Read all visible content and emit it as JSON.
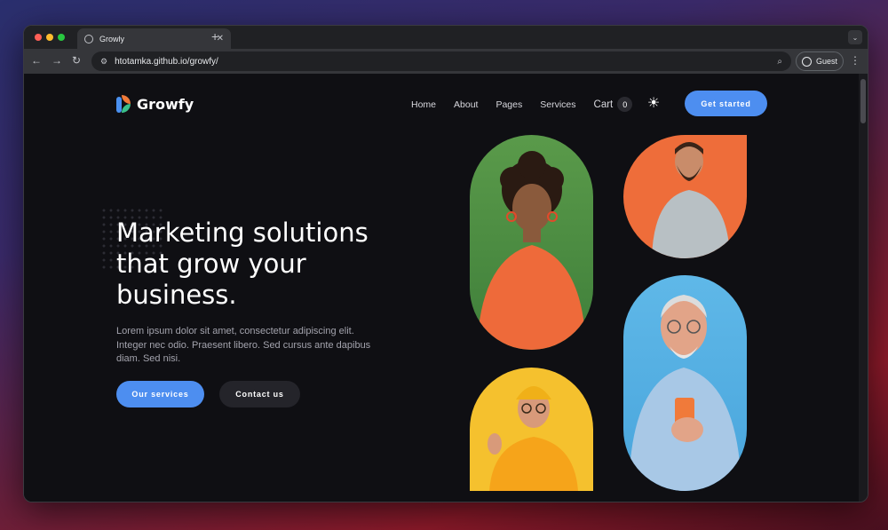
{
  "browser": {
    "tab_title": "Growly",
    "tab_close": "✕",
    "new_tab": "+",
    "tab_menu": "⌄",
    "url": "htotamka.github.io/growfy/",
    "profile_label": "Guest",
    "back": "←",
    "forward": "→",
    "reload": "↻",
    "menu": "⋮"
  },
  "site": {
    "brand": "Growfy",
    "nav": [
      "Home",
      "About",
      "Pages",
      "Services"
    ],
    "cart_label": "Cart",
    "cart_count": "0",
    "cta": "Get started"
  },
  "hero": {
    "headline": "Marketing solutions that grow your business.",
    "lead": "Lorem ipsum dolor sit amet, consectetur adipiscing elit. Integer nec odio. Praesent libero. Sed cursus ante dapibus diam. Sed nisi.",
    "primary_button": "Our services",
    "secondary_button": "Contact us"
  },
  "colors": {
    "accent": "#4d8ef0",
    "background": "#0f0f13",
    "photo_green": "#5a9a4a",
    "photo_orange": "#ee6d3a",
    "photo_yellow": "#f5c12e",
    "photo_blue": "#5fb8e8"
  },
  "icons": {
    "theme_toggle": "sun-icon",
    "zoom": "zoom-icon",
    "site_info": "tune-icon"
  }
}
